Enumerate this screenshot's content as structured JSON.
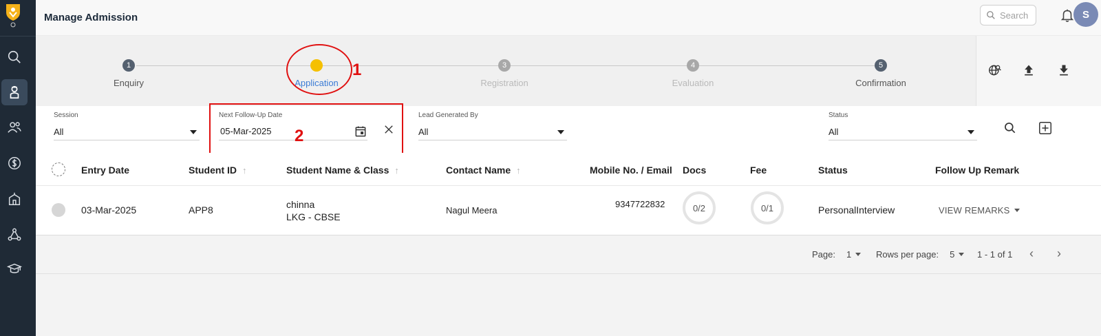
{
  "header": {
    "title": "Manage Admission",
    "search_placeholder": "Search",
    "avatar_initial": "S"
  },
  "stepper": {
    "steps": [
      {
        "num": "1",
        "label": "Enquiry",
        "state": "done"
      },
      {
        "num": "",
        "label": "Application",
        "state": "current"
      },
      {
        "num": "3",
        "label": "Registration",
        "state": "pending"
      },
      {
        "num": "4",
        "label": "Evaluation",
        "state": "pending"
      },
      {
        "num": "5",
        "label": "Confirmation",
        "state": "done"
      }
    ]
  },
  "annotations": {
    "one": "1",
    "two": "2"
  },
  "filters": {
    "session": {
      "label": "Session",
      "value": "All"
    },
    "follow_up": {
      "label": "Next Follow-Up Date",
      "value": "05-Mar-2025"
    },
    "lead": {
      "label": "Lead Generated By",
      "value": "All"
    },
    "status": {
      "label": "Status",
      "value": "All"
    }
  },
  "table": {
    "columns": [
      "Entry Date",
      "Student ID",
      "Student Name & Class",
      "Contact Name",
      "Mobile No. / Email",
      "Docs",
      "Fee",
      "Status",
      "Follow Up Remark"
    ],
    "rows": [
      {
        "entry_date": "03-Mar-2025",
        "student_id": "APP8",
        "student_name": "chinna",
        "student_class": "LKG - CBSE",
        "contact_name": "Nagul Meera",
        "mobile": "9347722832",
        "docs": "0/2",
        "fee": "0/1",
        "status": "PersonalInterview",
        "remark_label": "VIEW REMARKS"
      }
    ]
  },
  "pagination": {
    "page_label": "Page:",
    "page_value": "1",
    "rows_label": "Rows per page:",
    "rows_value": "5",
    "range": "1 - 1 of 1"
  },
  "colors": {
    "sidebar": "#1f2a36",
    "accent": "#3a7bd5",
    "current_step": "#f5c000",
    "annotation": "#e01010"
  }
}
